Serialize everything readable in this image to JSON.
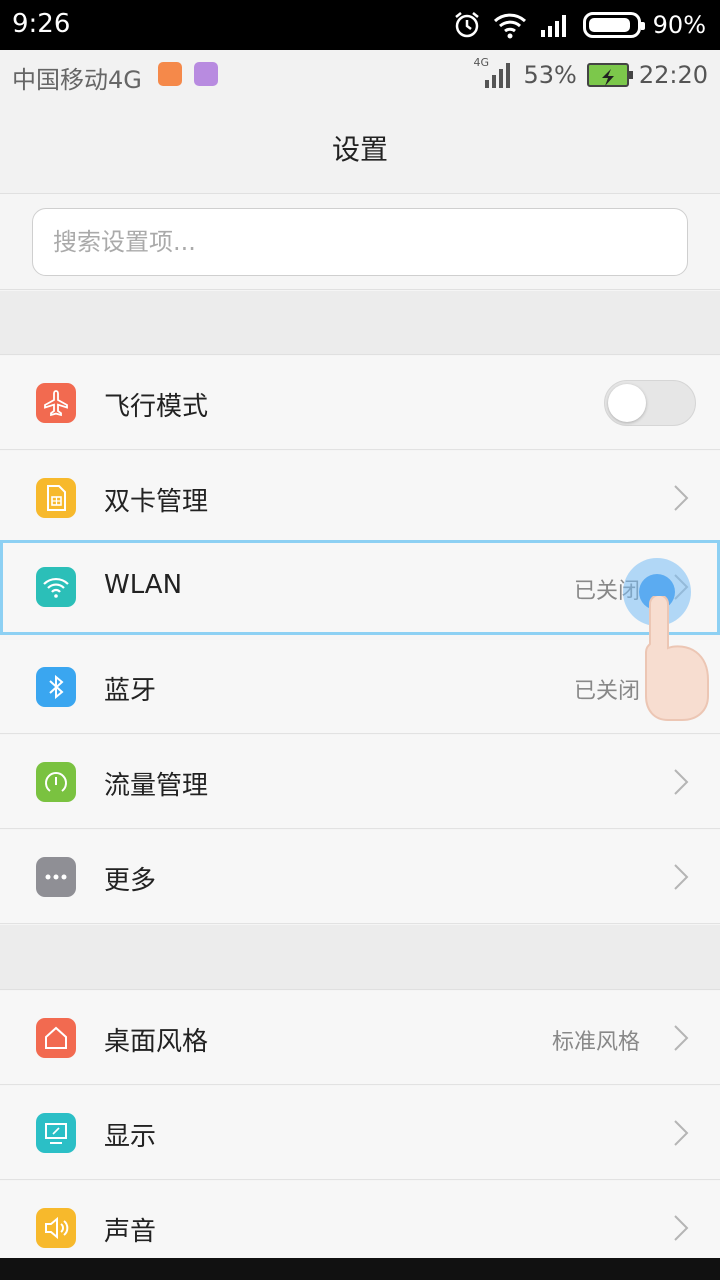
{
  "device_status": {
    "time": "9:26",
    "battery": "90%"
  },
  "phone_status": {
    "carrier": "中国移动4G",
    "network": "4G",
    "battery": "53%",
    "time": "22:20"
  },
  "header": {
    "title": "设置"
  },
  "search": {
    "placeholder": "搜索设置项..."
  },
  "rows": [
    {
      "label": "飞行模式",
      "icon": "airplane-icon",
      "color": "#f26a50",
      "control": "toggle",
      "toggle_on": false
    },
    {
      "label": "双卡管理",
      "icon": "sim-card-icon",
      "color": "#f7b92c",
      "control": "chevron"
    },
    {
      "label": "WLAN",
      "icon": "wifi-icon",
      "color": "#2bbfb8",
      "value": "已关闭",
      "control": "chevron",
      "selected": true
    },
    {
      "label": "蓝牙",
      "icon": "bluetooth-icon",
      "color": "#3aa6f0",
      "value": "已关闭",
      "control": "chevron"
    },
    {
      "label": "流量管理",
      "icon": "data-usage-icon",
      "color": "#7ac240",
      "control": "chevron"
    },
    {
      "label": "更多",
      "icon": "more-icon",
      "color": "#8f8f95",
      "control": "chevron"
    },
    {
      "label": "桌面风格",
      "icon": "home-icon",
      "color": "#f26a50",
      "value": "标准风格",
      "control": "chevron"
    },
    {
      "label": "显示",
      "icon": "display-icon",
      "color": "#2bbfc6",
      "control": "chevron"
    },
    {
      "label": "声音",
      "icon": "sound-icon",
      "color": "#f7b92c",
      "control": "chevron"
    }
  ]
}
